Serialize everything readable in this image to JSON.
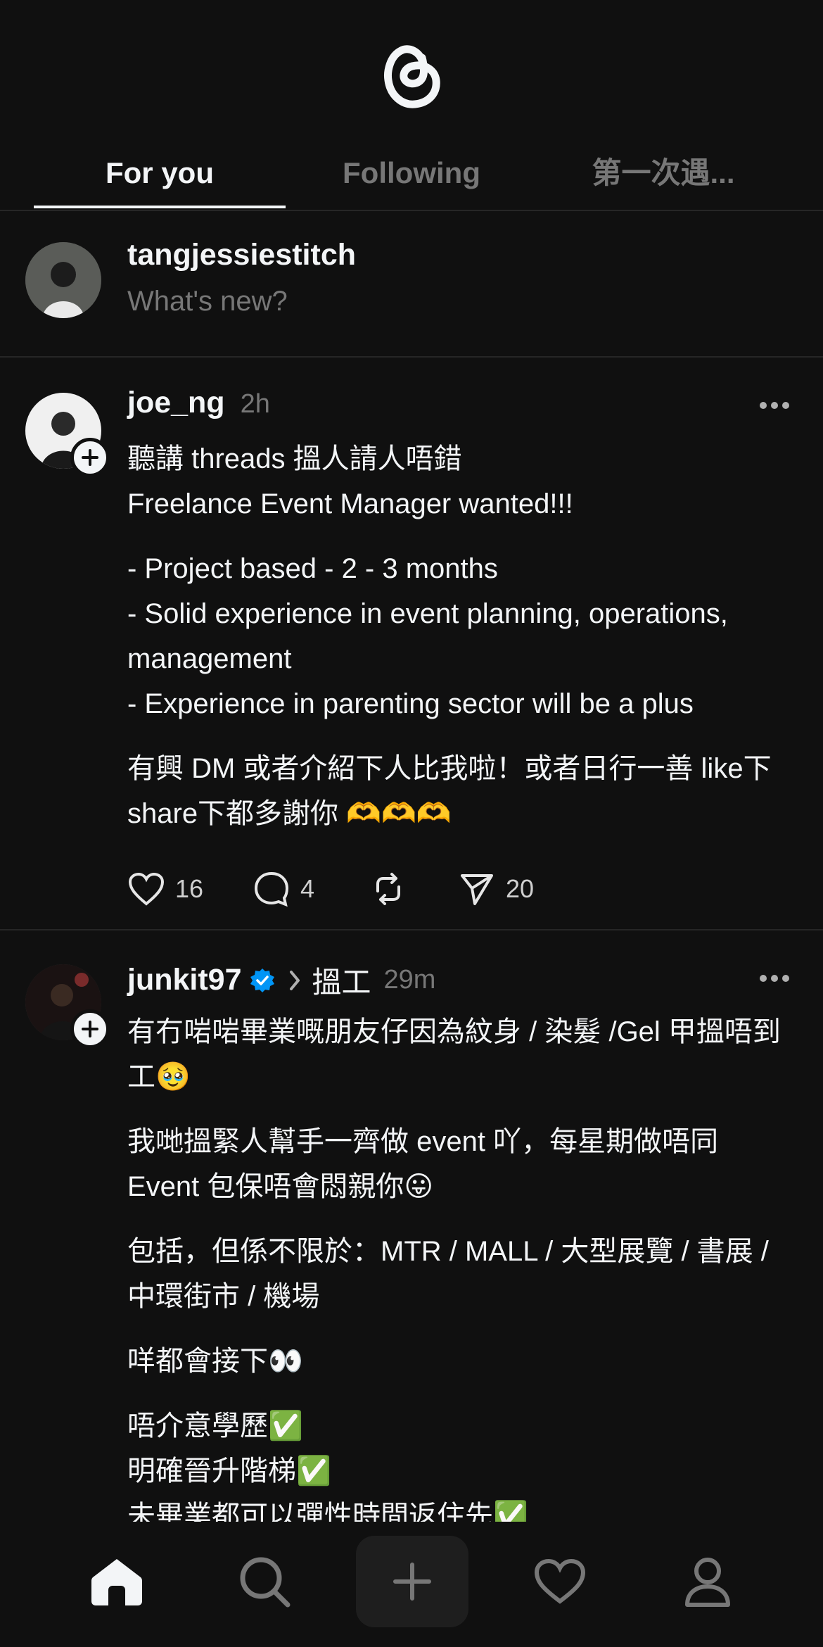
{
  "tabs": [
    {
      "label": "For you",
      "active": true
    },
    {
      "label": "Following",
      "active": false
    },
    {
      "label": "第一次遇...",
      "active": false
    }
  ],
  "composer": {
    "username": "tangjessiestitch",
    "placeholder": "What's new?"
  },
  "posts": [
    {
      "username": "joe_ng",
      "time": "2h",
      "paragraphs": [
        "聽講 threads 搵人請人唔錯\nFreelance Event Manager wanted!!!",
        "- Project based - 2 - 3 months\n- Solid experience in event planning, operations, management\n- Experience in parenting sector will be a plus",
        "有興 DM 或者介紹下人比我啦！或者日行一善 like下 share下都多謝你 🫶🫶🫶"
      ],
      "likes": "16",
      "replies": "4",
      "shares": "20"
    },
    {
      "username": "junkit97",
      "verified": true,
      "topic": "搵工",
      "time": "29m",
      "paragraphs": [
        "有冇啱啱畢業嘅朋友仔因為紋身 / 染髮 /Gel 甲搵唔到工🥹",
        "我哋搵緊人幫手一齊做 event 吖，每星期做唔同 Event 包保唔會悶親你😛",
        "包括，但係不限於：MTR / MALL / 大型展覽 / 書展 / 中環街市 / 機場",
        "咩都會接下👀",
        "唔介意學歷✅\n明確晉升階梯✅\n未畢業都可以彈性時間返住先✅"
      ]
    }
  ],
  "nav": [
    "home-icon",
    "search-icon",
    "compose-icon",
    "activity-heart-icon",
    "profile-icon"
  ],
  "colors": {
    "background": "#101010",
    "text": "#f3f5f7",
    "muted": "#777777",
    "divider": "#262626",
    "verified": "#0095f6"
  }
}
